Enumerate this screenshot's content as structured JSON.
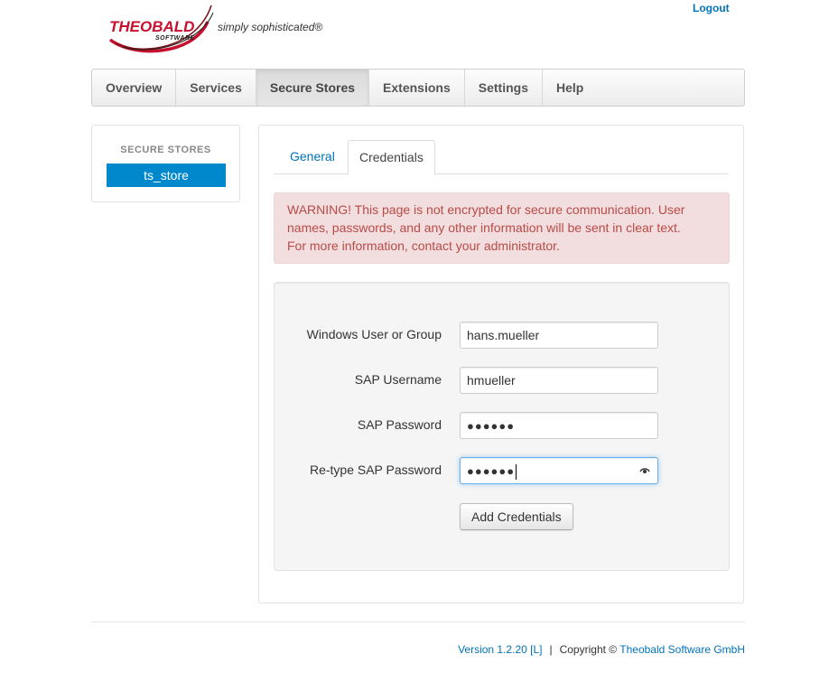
{
  "header": {
    "logo_word": "THEOBALD",
    "logo_sub": "SOFTWARE",
    "slogan": "simply sophisticated®",
    "logout_label": "Logout"
  },
  "nav": {
    "items": [
      {
        "label": "Overview"
      },
      {
        "label": "Services"
      },
      {
        "label": "Secure Stores"
      },
      {
        "label": "Extensions"
      },
      {
        "label": "Settings"
      },
      {
        "label": "Help"
      }
    ],
    "active": "Secure Stores"
  },
  "sidebar": {
    "header": "SECURE STORES",
    "items": [
      {
        "label": "ts_store",
        "selected": true
      }
    ]
  },
  "tabs": {
    "general": "General",
    "credentials": "Credentials",
    "active": "Credentials"
  },
  "alert": {
    "line1": "WARNING! This page is not encrypted for secure communication. User",
    "line2": "names, passwords, and any other information will be sent in clear text.",
    "line3": "For more information, contact your administrator."
  },
  "form": {
    "windows_user_label": "Windows User or Group",
    "windows_user_value": "hans.mueller",
    "sap_username_label": "SAP Username",
    "sap_username_value": "hmueller",
    "sap_password_label": "SAP Password",
    "sap_password_mask": "●●●●●●",
    "retype_password_label": "Re-type SAP Password",
    "retype_password_mask": "●●●●●●",
    "submit_label": "Add Credentials"
  },
  "footer": {
    "version": "Version 1.2.20 [L]",
    "separator": "|",
    "copyright": "Copyright ©",
    "company": "Theobald Software GmbH"
  },
  "colors": {
    "accent": "#0088cc",
    "link": "#0073b7",
    "alert_bg": "#f2dede",
    "alert_text": "#b94a48",
    "brand_red": "#c8102e"
  }
}
